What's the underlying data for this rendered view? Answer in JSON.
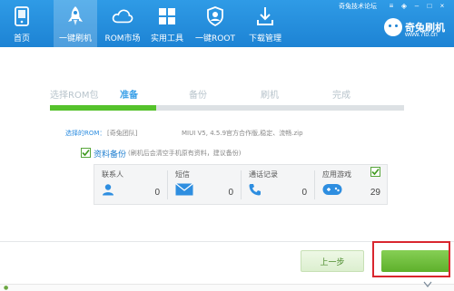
{
  "nav": {
    "items": [
      {
        "label": "首页",
        "icon": "phone-home-icon",
        "active": false
      },
      {
        "label": "一键刷机",
        "icon": "rocket-icon",
        "active": true
      },
      {
        "label": "ROM市场",
        "icon": "cloud-icon",
        "active": false
      },
      {
        "label": "实用工具",
        "icon": "windows-grid-icon",
        "active": false
      },
      {
        "label": "一键ROOT",
        "icon": "shield-icon",
        "active": false
      },
      {
        "label": "下载管理",
        "icon": "download-icon",
        "active": false
      }
    ],
    "top_link": "奇兔技术论坛",
    "logo_name": "奇兔刷机",
    "logo_site": "www.7to.cn",
    "accent": "#1d83d4"
  },
  "steps": {
    "items": [
      "选择ROM包",
      "准备",
      "备份",
      "刷机",
      "完成"
    ],
    "current": 1,
    "progress": 0.3
  },
  "rom": {
    "label": "选择的ROM：",
    "team": "[奇兔团队]",
    "file": "MIUI V5, 4.5.9官方合作版,稳定、流畅.zip"
  },
  "backup": {
    "label": "资料备份",
    "desc": "(刷机后会清空手机原有资料，建议备份)",
    "checked": true,
    "items": [
      {
        "label": "联系人",
        "icon": "contact-icon",
        "count": "0"
      },
      {
        "label": "短信",
        "icon": "sms-icon",
        "count": "0"
      },
      {
        "label": "通话记录",
        "icon": "call-log-icon",
        "count": "0"
      },
      {
        "label": "应用游戏",
        "icon": "gamepad-icon",
        "count": "29",
        "checked": true
      }
    ]
  },
  "buttons": {
    "prev": "上一步",
    "next": ""
  },
  "colors": {
    "progress_fill": "#55c22b",
    "highlight_border": "#d9262e"
  }
}
